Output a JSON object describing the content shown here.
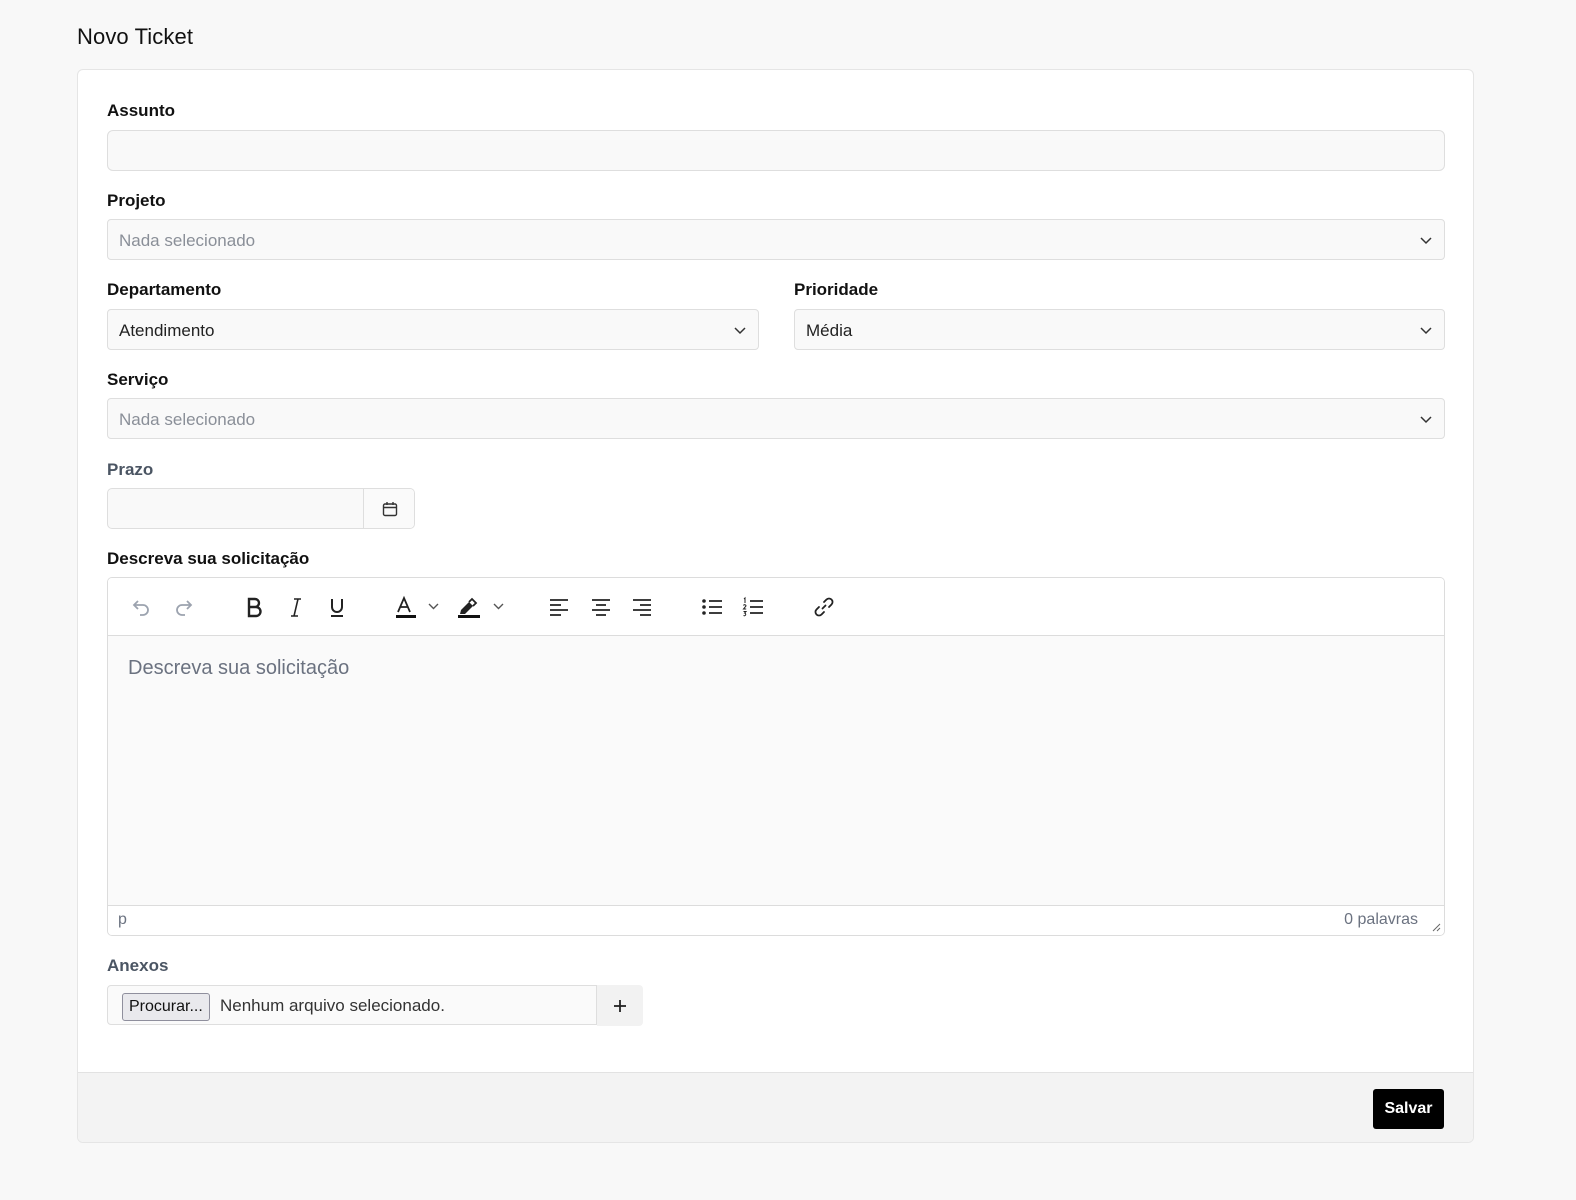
{
  "page": {
    "title": "Novo Ticket"
  },
  "form": {
    "subject": {
      "label": "Assunto",
      "value": ""
    },
    "project": {
      "label": "Projeto",
      "value": "Nada selecionado",
      "is_placeholder": true
    },
    "department": {
      "label": "Departamento",
      "value": "Atendimento"
    },
    "priority": {
      "label": "Prioridade",
      "value": "Média"
    },
    "service": {
      "label": "Serviço",
      "value": "Nada selecionado",
      "is_placeholder": true
    },
    "deadline": {
      "label": "Prazo",
      "value": ""
    },
    "description": {
      "label": "Descreva sua solicitação",
      "placeholder": "Descreva sua solicitação",
      "status_path": "p",
      "word_count": "0 palavras",
      "toolbar": [
        "undo-icon",
        "redo-icon",
        "bold-icon",
        "italic-icon",
        "underline-icon",
        "text-color-icon",
        "highlight-icon",
        "align-left-icon",
        "align-center-icon",
        "align-right-icon",
        "bullet-list-icon",
        "numbered-list-icon",
        "link-icon"
      ]
    },
    "attachments": {
      "label": "Anexos",
      "browse_label": "Procurar...",
      "file_status": "Nenhum arquivo selecionado.",
      "add_icon": "plus-icon"
    },
    "save_label": "Salvar"
  },
  "colors": {
    "primary_button": "#000000",
    "page_background": "#f8f8f8"
  }
}
